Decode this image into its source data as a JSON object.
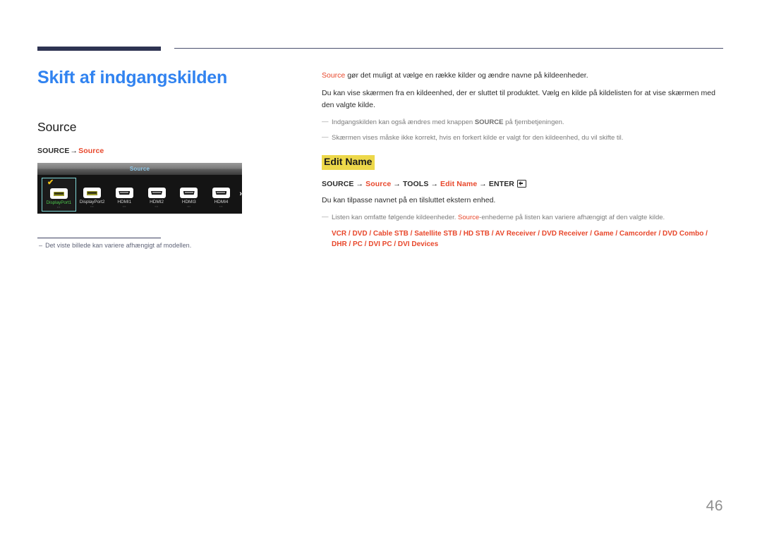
{
  "page": {
    "number": "46"
  },
  "left": {
    "title": "Skift af indgangskilden",
    "section_title": "Source",
    "nav": {
      "root": "SOURCE",
      "arrow": "→",
      "target": "Source"
    },
    "footnote": {
      "dash": "–",
      "text": "Det viste billede kan variere afhængigt af modellen."
    }
  },
  "osd": {
    "header_title": "Source",
    "next_arrow": "›",
    "check_mark": "✔",
    "items": [
      {
        "label": "DisplayPort1",
        "sub": "▪▪▪",
        "type": "displayport",
        "selected": true
      },
      {
        "label": "DisplayPort2",
        "sub": "▪▪▪",
        "type": "displayport",
        "selected": false
      },
      {
        "label": "HDMI1",
        "sub": "▪▪▪",
        "type": "hdmi",
        "selected": false
      },
      {
        "label": "HDMI2",
        "sub": "▪▪▪",
        "type": "hdmi",
        "selected": false
      },
      {
        "label": "HDMI3",
        "sub": "▪▪▪",
        "type": "hdmi",
        "selected": false
      },
      {
        "label": "HDMI4",
        "sub": "▪▪▪",
        "type": "hdmi",
        "selected": false
      }
    ]
  },
  "right": {
    "intro_accent": "Source",
    "intro_rest": " gør det muligt at vælge en række kilder og ændre navne på kildeenheder.",
    "paragraph": "Du kan vise skærmen fra en kildeenhed, der er sluttet til produktet. Vælg en kilde på kildelisten for at vise skærmen med den valgte kilde.",
    "notes": [
      {
        "dash": "—",
        "pre": "Indgangskilden kan også ændres med knappen ",
        "strong": "SOURCE",
        "post": " på fjernbetjeningen."
      },
      {
        "dash": "—",
        "pre": "Skærmen vises måske ikke korrekt, hvis en forkert kilde er valgt for den kildeenhed, du vil skifte til.",
        "strong": "",
        "post": ""
      }
    ],
    "sub_head": "Edit Name",
    "sub_nav": {
      "a": "SOURCE",
      "arrow1": "→",
      "b": "Source",
      "arrow2": "→",
      "c": "TOOLS",
      "arrow3": "→",
      "d": "Edit Name",
      "arrow4": "→",
      "e": "ENTER"
    },
    "sub_paragraph": "Du kan tilpasse navnet på en tilsluttet ekstern enhed.",
    "list_note": {
      "dash": "—",
      "pre": "Listen kan omfatte følgende kildeenheder. ",
      "accent": "Source",
      "post": "-enhederne på listen kan variere afhængigt af den valgte kilde."
    },
    "device_list": "VCR / DVD / Cable STB / Satellite STB / HD STB / AV Receiver / DVD Receiver / Game / Camcorder / DVD Combo / DHR / PC / DVI PC / DVI Devices"
  }
}
